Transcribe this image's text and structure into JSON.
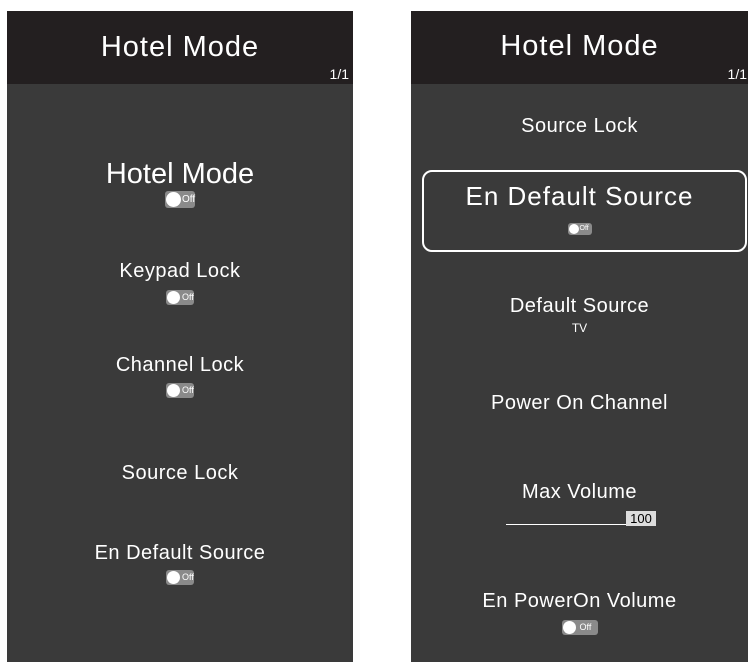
{
  "left": {
    "title": "Hotel Mode",
    "page": "1/1",
    "items": [
      {
        "label": "Hotel Mode",
        "toggle": "Off"
      },
      {
        "label": "Keypad Lock",
        "toggle": "Off"
      },
      {
        "label": "Channel Lock",
        "toggle": "Off"
      },
      {
        "label": "Source Lock"
      },
      {
        "label": "En Default Source",
        "toggle": "Off"
      }
    ]
  },
  "right": {
    "title": "Hotel Mode",
    "page": "1/1",
    "items": [
      {
        "label": "Source Lock"
      },
      {
        "label": "En Default Source",
        "toggle": "Off",
        "selected": true
      },
      {
        "label": "Default Source",
        "value": "TV"
      },
      {
        "label": "Power On Channel"
      },
      {
        "label": "Max Volume",
        "value": "100",
        "level": 1.0
      },
      {
        "label": "En PowerOn Volume",
        "toggle": "Off"
      }
    ]
  },
  "colors": {
    "panel": "#3a3a3a",
    "header": "#231f20",
    "toggle": "#8a8a8a"
  }
}
